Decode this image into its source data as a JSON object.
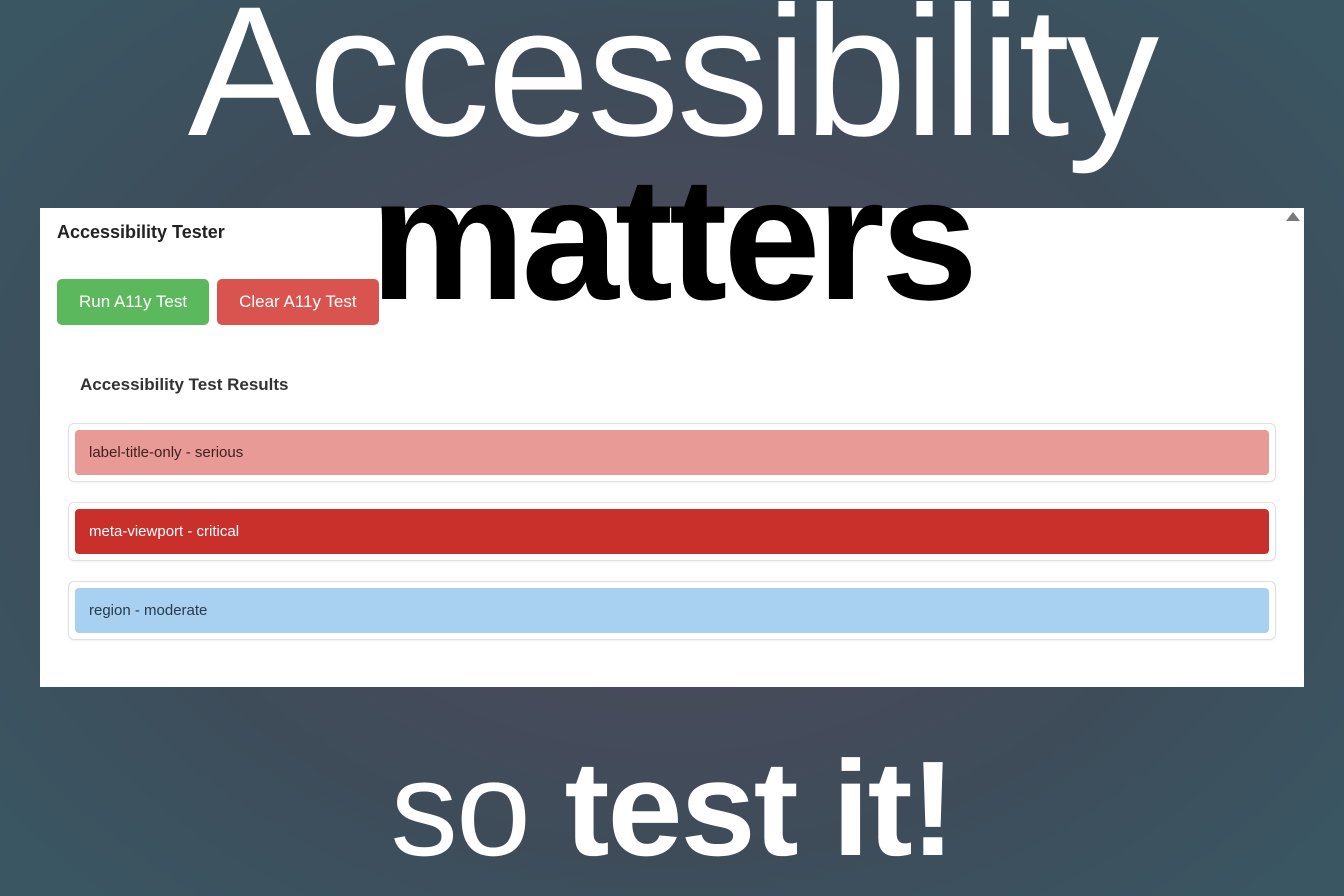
{
  "background": {
    "line1": "Accessibility",
    "line2": "matters",
    "line3_light": "so ",
    "line3_bold": "test it!"
  },
  "panel": {
    "title": "Accessibility Tester",
    "buttons": {
      "run": "Run A11y Test",
      "clear": "Clear A11y Test"
    },
    "results_header": "Accessibility Test Results",
    "results": [
      {
        "id": "label-title-only",
        "severity": "serious",
        "label": "label-title-only - serious"
      },
      {
        "id": "meta-viewport",
        "severity": "critical",
        "label": "meta-viewport - critical"
      },
      {
        "id": "region",
        "severity": "moderate",
        "label": "region - moderate"
      }
    ]
  },
  "colors": {
    "btn_green": "#5cb85c",
    "btn_red": "#d9534f",
    "sev_serious": "#e89a97",
    "sev_critical": "#c9302c",
    "sev_moderate": "#a8d0f0"
  }
}
